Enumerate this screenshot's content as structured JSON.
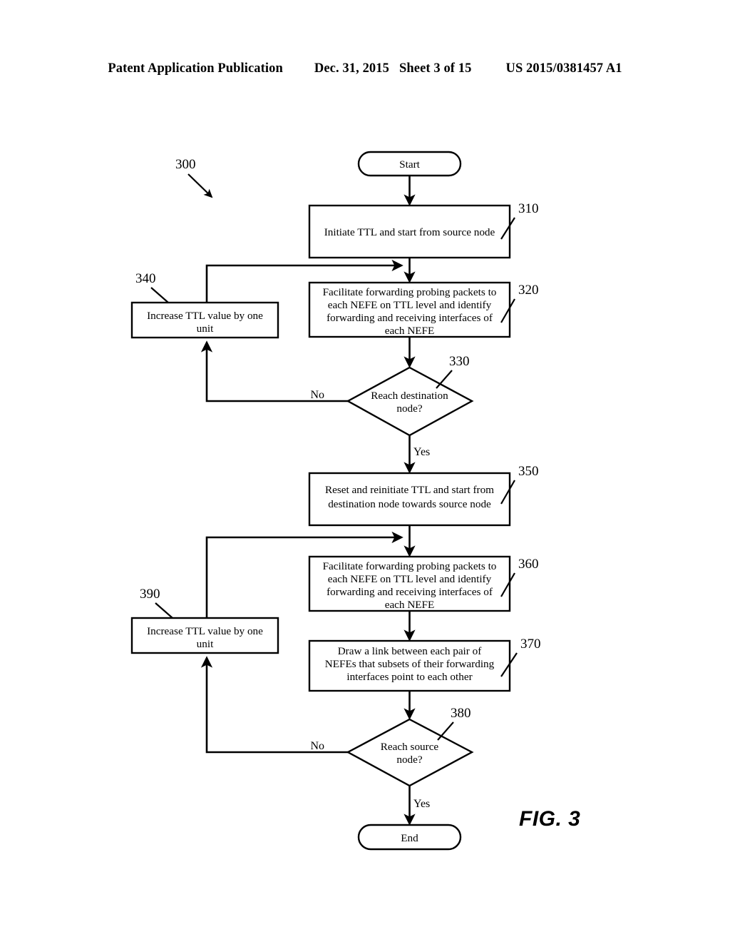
{
  "header": {
    "publication": "Patent Application Publication",
    "date": "Dec. 31, 2015",
    "sheet": "Sheet 3 of 15",
    "patent_number": "US 2015/0381457 A1"
  },
  "figure": {
    "label": "FIG. 3",
    "diagram_reference": "300"
  },
  "flowchart": {
    "start": {
      "label": "Start"
    },
    "end": {
      "label": "End"
    },
    "steps": [
      {
        "ref": "310",
        "lines": [
          "Initiate TTL and start from source node"
        ]
      },
      {
        "ref": "320",
        "lines": [
          "Facilitate forwarding probing packets to",
          "each NEFE on TTL level and identify",
          "forwarding and receiving interfaces of",
          "each NEFE"
        ]
      },
      {
        "ref": "340",
        "lines": [
          "Increase TTL value by one",
          "unit"
        ]
      },
      {
        "ref": "350",
        "lines": [
          "Reset and reinitiate TTL and start from",
          "destination node towards source node"
        ]
      },
      {
        "ref": "360",
        "lines": [
          "Facilitate forwarding probing packets to",
          "each NEFE on TTL level and identify",
          "forwarding and receiving interfaces of",
          "each NEFE"
        ]
      },
      {
        "ref": "370",
        "lines": [
          "Draw a link between each pair of",
          "NEFEs that subsets of their forwarding",
          "interfaces point to each other"
        ]
      },
      {
        "ref": "390",
        "lines": [
          "Increase TTL value by one",
          "unit"
        ]
      }
    ],
    "decisions": [
      {
        "ref": "330",
        "lines": [
          "Reach destination",
          "node?"
        ],
        "no_label": "No",
        "yes_label": "Yes"
      },
      {
        "ref": "380",
        "lines": [
          "Reach source",
          "node?"
        ],
        "no_label": "No",
        "yes_label": "Yes"
      }
    ]
  },
  "colors": {
    "ink": "#000000",
    "paper": "#ffffff"
  }
}
